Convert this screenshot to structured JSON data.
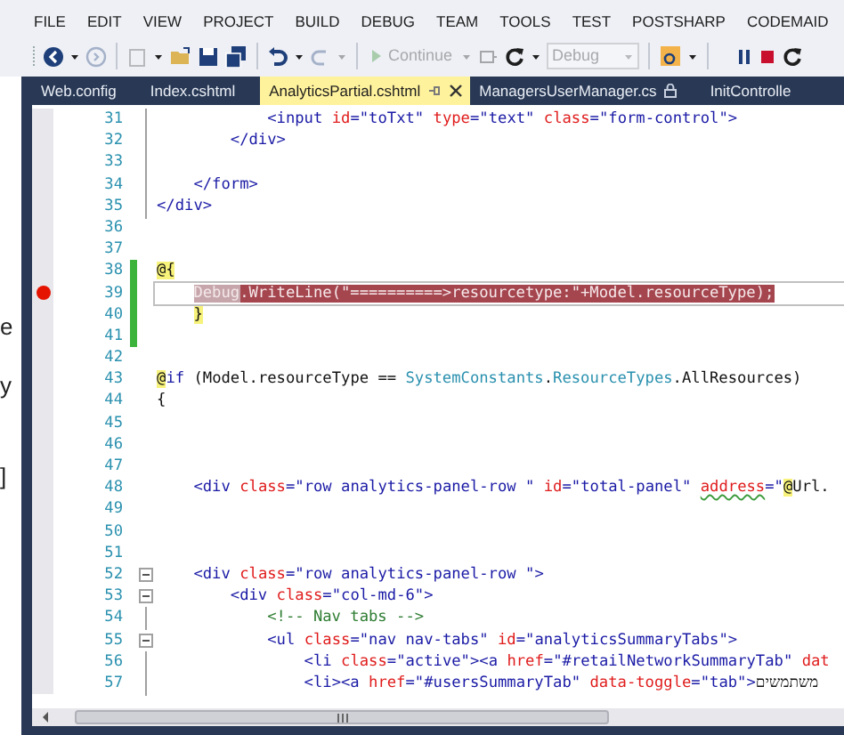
{
  "background_window": {
    "fragments": [
      "e",
      "y",
      "]"
    ]
  },
  "menu": [
    "FILE",
    "EDIT",
    "VIEW",
    "PROJECT",
    "BUILD",
    "DEBUG",
    "TEAM",
    "TOOLS",
    "TEST",
    "POSTSHARP",
    "CODEMAID"
  ],
  "toolbar": [
    {
      "kind": "back",
      "disabled": false
    },
    {
      "kind": "dropdown",
      "disabled": false
    },
    {
      "kind": "forward",
      "disabled": true
    },
    {
      "kind": "separator"
    },
    {
      "kind": "new",
      "disabled": true
    },
    {
      "kind": "dropdown",
      "disabled": false
    },
    {
      "kind": "open",
      "disabled": false
    },
    {
      "kind": "save",
      "disabled": false
    },
    {
      "kind": "save_all",
      "disabled": false
    },
    {
      "kind": "separator"
    },
    {
      "kind": "undo",
      "disabled": false
    },
    {
      "kind": "dropdown",
      "disabled": false
    },
    {
      "kind": "redo",
      "disabled": true
    },
    {
      "kind": "dropdown",
      "disabled": true
    },
    {
      "kind": "separator"
    },
    {
      "kind": "continue",
      "label": "Continue",
      "disabled": true
    },
    {
      "kind": "dropdown",
      "disabled": true
    },
    {
      "kind": "step",
      "disabled": true
    },
    {
      "kind": "refresh",
      "disabled": false
    },
    {
      "kind": "dropdown",
      "disabled": false
    },
    {
      "kind": "combo",
      "value": "Debug",
      "disabled": true
    },
    {
      "kind": "separator"
    },
    {
      "kind": "find",
      "disabled": false
    },
    {
      "kind": "dropdown",
      "disabled": false
    },
    {
      "kind": "separator"
    },
    {
      "kind": "pause",
      "disabled": false
    },
    {
      "kind": "stop",
      "disabled": false
    },
    {
      "kind": "restart",
      "disabled": false
    }
  ],
  "tabs": [
    {
      "label": "Web.config",
      "selected": false,
      "read_only": false
    },
    {
      "label": "Index.cshtml",
      "selected": false,
      "read_only": false
    },
    {
      "label": "AnalyticsPartial.cshtml",
      "selected": true,
      "read_only": false
    },
    {
      "label": "ManagersUserManager.cs",
      "selected": false,
      "read_only": true
    },
    {
      "label": "InitControlle",
      "selected": false,
      "read_only": false
    }
  ],
  "editor": {
    "lines": [
      {
        "n": "31",
        "breakpoint": false,
        "changed": false,
        "collapsible": false,
        "in_block": true,
        "tokens": [
          {
            "kind": "tag",
            "text": "            <input"
          },
          {
            "kind": "attr",
            "text": " id"
          },
          {
            "kind": "tag",
            "text": "="
          },
          {
            "kind": "str",
            "text": "\"toTxt\""
          },
          {
            "kind": "attr",
            "text": " type"
          },
          {
            "kind": "tag",
            "text": "="
          },
          {
            "kind": "str",
            "text": "\"text\""
          },
          {
            "kind": "attr",
            "text": " class"
          },
          {
            "kind": "tag",
            "text": "="
          },
          {
            "kind": "str",
            "text": "\"form-control\""
          },
          {
            "kind": "tag",
            "text": ">"
          }
        ]
      },
      {
        "n": "32",
        "breakpoint": false,
        "changed": false,
        "collapsible": false,
        "in_block": true,
        "tokens": [
          {
            "kind": "tag",
            "text": "        </div>"
          }
        ]
      },
      {
        "n": "33",
        "breakpoint": false,
        "changed": false,
        "collapsible": false,
        "in_block": true
      },
      {
        "n": "34",
        "breakpoint": false,
        "changed": false,
        "collapsible": false,
        "in_block": true,
        "tokens": [
          {
            "kind": "tag",
            "text": "    </form>"
          }
        ]
      },
      {
        "n": "35",
        "breakpoint": false,
        "changed": false,
        "collapsible": false,
        "in_block": true,
        "tokens": [
          {
            "kind": "tag",
            "text": "</div>"
          }
        ]
      },
      {
        "n": "36",
        "breakpoint": false,
        "changed": false,
        "collapsible": false,
        "in_block": false
      },
      {
        "n": "37",
        "breakpoint": false,
        "changed": false,
        "collapsible": false,
        "in_block": false
      },
      {
        "n": "38",
        "breakpoint": false,
        "changed": true,
        "collapsible": false,
        "in_block": false,
        "tokens": [
          {
            "kind": "razor",
            "text": "@{"
          }
        ]
      },
      {
        "n": "39",
        "breakpoint": true,
        "changed": true,
        "collapsible": false,
        "in_block": false,
        "tokens": [
          {
            "kind": "current",
            "text": "    Debug"
          },
          {
            "kind": "break",
            "text": ".WriteLine(\"==========>resourcetype:\"+Model.resourceType);"
          }
        ]
      },
      {
        "n": "40",
        "breakpoint": false,
        "changed": true,
        "collapsible": false,
        "in_block": false,
        "tokens": [
          {
            "kind": "razor",
            "text": "    }"
          }
        ]
      },
      {
        "n": "41",
        "breakpoint": false,
        "changed": true,
        "collapsible": false,
        "in_block": false
      },
      {
        "n": "42",
        "breakpoint": false,
        "changed": false,
        "collapsible": false,
        "in_block": false
      },
      {
        "n": "43",
        "breakpoint": false,
        "changed": false,
        "collapsible": false,
        "in_block": false,
        "tokens": [
          {
            "kind": "razor",
            "text": "@"
          },
          {
            "kind": "keyword",
            "text": "if"
          },
          {
            "kind": "plain",
            "text": " (Model.resourceType == "
          },
          {
            "kind": "type",
            "text": "SystemConstants"
          },
          {
            "kind": "plain",
            "text": "."
          },
          {
            "kind": "type",
            "text": "ResourceTypes"
          },
          {
            "kind": "plain",
            "text": ".AllResources)"
          }
        ]
      },
      {
        "n": "44",
        "breakpoint": false,
        "changed": false,
        "collapsible": false,
        "in_block": false,
        "tokens": [
          {
            "kind": "plain",
            "text": "{"
          }
        ]
      },
      {
        "n": "45",
        "breakpoint": false,
        "changed": false,
        "collapsible": false,
        "in_block": false
      },
      {
        "n": "46",
        "breakpoint": false,
        "changed": false,
        "collapsible": false,
        "in_block": false
      },
      {
        "n": "47",
        "breakpoint": false,
        "changed": false,
        "collapsible": false,
        "in_block": false
      },
      {
        "n": "48",
        "breakpoint": false,
        "changed": false,
        "collapsible": false,
        "in_block": false,
        "tokens": [
          {
            "kind": "tag",
            "text": "    <div"
          },
          {
            "kind": "attr",
            "text": " class"
          },
          {
            "kind": "tag",
            "text": "="
          },
          {
            "kind": "str",
            "text": "\"row analytics-panel-row \""
          },
          {
            "kind": "attr",
            "text": " id"
          },
          {
            "kind": "tag",
            "text": "="
          },
          {
            "kind": "str",
            "text": "\"total-panel\""
          },
          {
            "kind": "warn",
            "text": " address"
          },
          {
            "kind": "tag",
            "text": "="
          },
          {
            "kind": "str",
            "text": "\""
          },
          {
            "kind": "razor",
            "text": "@"
          },
          {
            "kind": "plain",
            "text": "Url."
          }
        ]
      },
      {
        "n": "49",
        "breakpoint": false,
        "changed": false,
        "collapsible": false,
        "in_block": false
      },
      {
        "n": "50",
        "breakpoint": false,
        "changed": false,
        "collapsible": false,
        "in_block": false
      },
      {
        "n": "51",
        "breakpoint": false,
        "changed": false,
        "collapsible": false,
        "in_block": false
      },
      {
        "n": "52",
        "breakpoint": false,
        "changed": false,
        "collapsible": true,
        "in_block": false,
        "tokens": [
          {
            "kind": "tag",
            "text": "    <div"
          },
          {
            "kind": "attr",
            "text": " class"
          },
          {
            "kind": "tag",
            "text": "="
          },
          {
            "kind": "str",
            "text": "\"row analytics-panel-row \""
          },
          {
            "kind": "tag",
            "text": ">"
          }
        ]
      },
      {
        "n": "53",
        "breakpoint": false,
        "changed": false,
        "collapsible": true,
        "in_block": true,
        "tokens": [
          {
            "kind": "tag",
            "text": "        <div"
          },
          {
            "kind": "attr",
            "text": " class"
          },
          {
            "kind": "tag",
            "text": "="
          },
          {
            "kind": "str",
            "text": "\"col-md-6\""
          },
          {
            "kind": "tag",
            "text": ">"
          }
        ]
      },
      {
        "n": "54",
        "breakpoint": false,
        "changed": false,
        "collapsible": false,
        "in_block": true,
        "tokens": [
          {
            "kind": "comment",
            "text": "            <!-- Nav tabs -->"
          }
        ]
      },
      {
        "n": "55",
        "breakpoint": false,
        "changed": false,
        "collapsible": true,
        "in_block": true,
        "tokens": [
          {
            "kind": "tag",
            "text": "            <ul"
          },
          {
            "kind": "attr",
            "text": " class"
          },
          {
            "kind": "tag",
            "text": "="
          },
          {
            "kind": "str",
            "text": "\"nav nav-tabs\""
          },
          {
            "kind": "attr",
            "text": " id"
          },
          {
            "kind": "tag",
            "text": "="
          },
          {
            "kind": "str",
            "text": "\"analyticsSummaryTabs\""
          },
          {
            "kind": "tag",
            "text": ">"
          }
        ]
      },
      {
        "n": "56",
        "breakpoint": false,
        "changed": false,
        "collapsible": false,
        "in_block": true,
        "tokens": [
          {
            "kind": "tag",
            "text": "                <li"
          },
          {
            "kind": "attr",
            "text": " class"
          },
          {
            "kind": "tag",
            "text": "="
          },
          {
            "kind": "str",
            "text": "\"active\""
          },
          {
            "kind": "tag",
            "text": "><a"
          },
          {
            "kind": "attr",
            "text": " href"
          },
          {
            "kind": "tag",
            "text": "="
          },
          {
            "kind": "str",
            "text": "\"#retailNetworkSummaryTab\""
          },
          {
            "kind": "attr",
            "text": " dat"
          }
        ]
      },
      {
        "n": "57",
        "breakpoint": false,
        "changed": false,
        "collapsible": false,
        "in_block": true,
        "tokens": [
          {
            "kind": "tag",
            "text": "                <li><a"
          },
          {
            "kind": "attr",
            "text": " href"
          },
          {
            "kind": "tag",
            "text": "="
          },
          {
            "kind": "str",
            "text": "\"#usersSummaryTab\""
          },
          {
            "kind": "attr",
            "text": " data-toggle"
          },
          {
            "kind": "tag",
            "text": "="
          },
          {
            "kind": "str",
            "text": "\"tab\""
          },
          {
            "kind": "tag",
            "text": ">"
          },
          {
            "kind": "plain",
            "text": "משתמשים"
          }
        ]
      }
    ]
  }
}
